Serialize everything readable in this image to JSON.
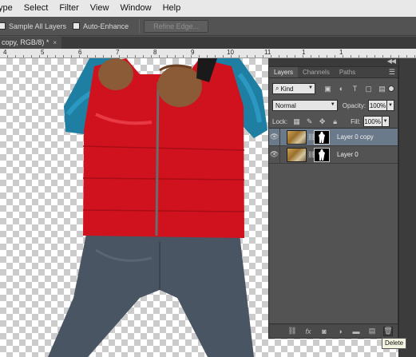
{
  "menubar": {
    "items": [
      "ype",
      "Select",
      "Filter",
      "View",
      "Window",
      "Help"
    ]
  },
  "options": {
    "sample_all_layers": "Sample All Layers",
    "auto_enhance": "Auto-Enhance",
    "refine_edge": "Refine Edge..."
  },
  "document": {
    "tab_title": "copy, RGB/8) *",
    "close_glyph": "×"
  },
  "ruler": {
    "labels": [
      "4",
      "5",
      "6",
      "7",
      "8",
      "9",
      "10",
      "11",
      "1",
      "1"
    ]
  },
  "panel": {
    "tabs": [
      "Layers",
      "Channels",
      "Paths"
    ],
    "kind_label": "Kind",
    "blend_mode": "Normal",
    "opacity_label": "Opacity:",
    "opacity_value": "100%",
    "lock_label": "Lock:",
    "fill_label": "Fill:",
    "fill_value": "100%",
    "layers": [
      {
        "name": "Layer 0 copy",
        "selected": true
      },
      {
        "name": "Layer 0",
        "selected": false
      }
    ]
  },
  "tooltip": "Delete",
  "colors": {
    "vest": "#d0121e",
    "sleeve": "#1e7fa3",
    "jeans": "#4a5563",
    "skin": "#8b5a36",
    "selected_layer": "#6b7a8a"
  }
}
